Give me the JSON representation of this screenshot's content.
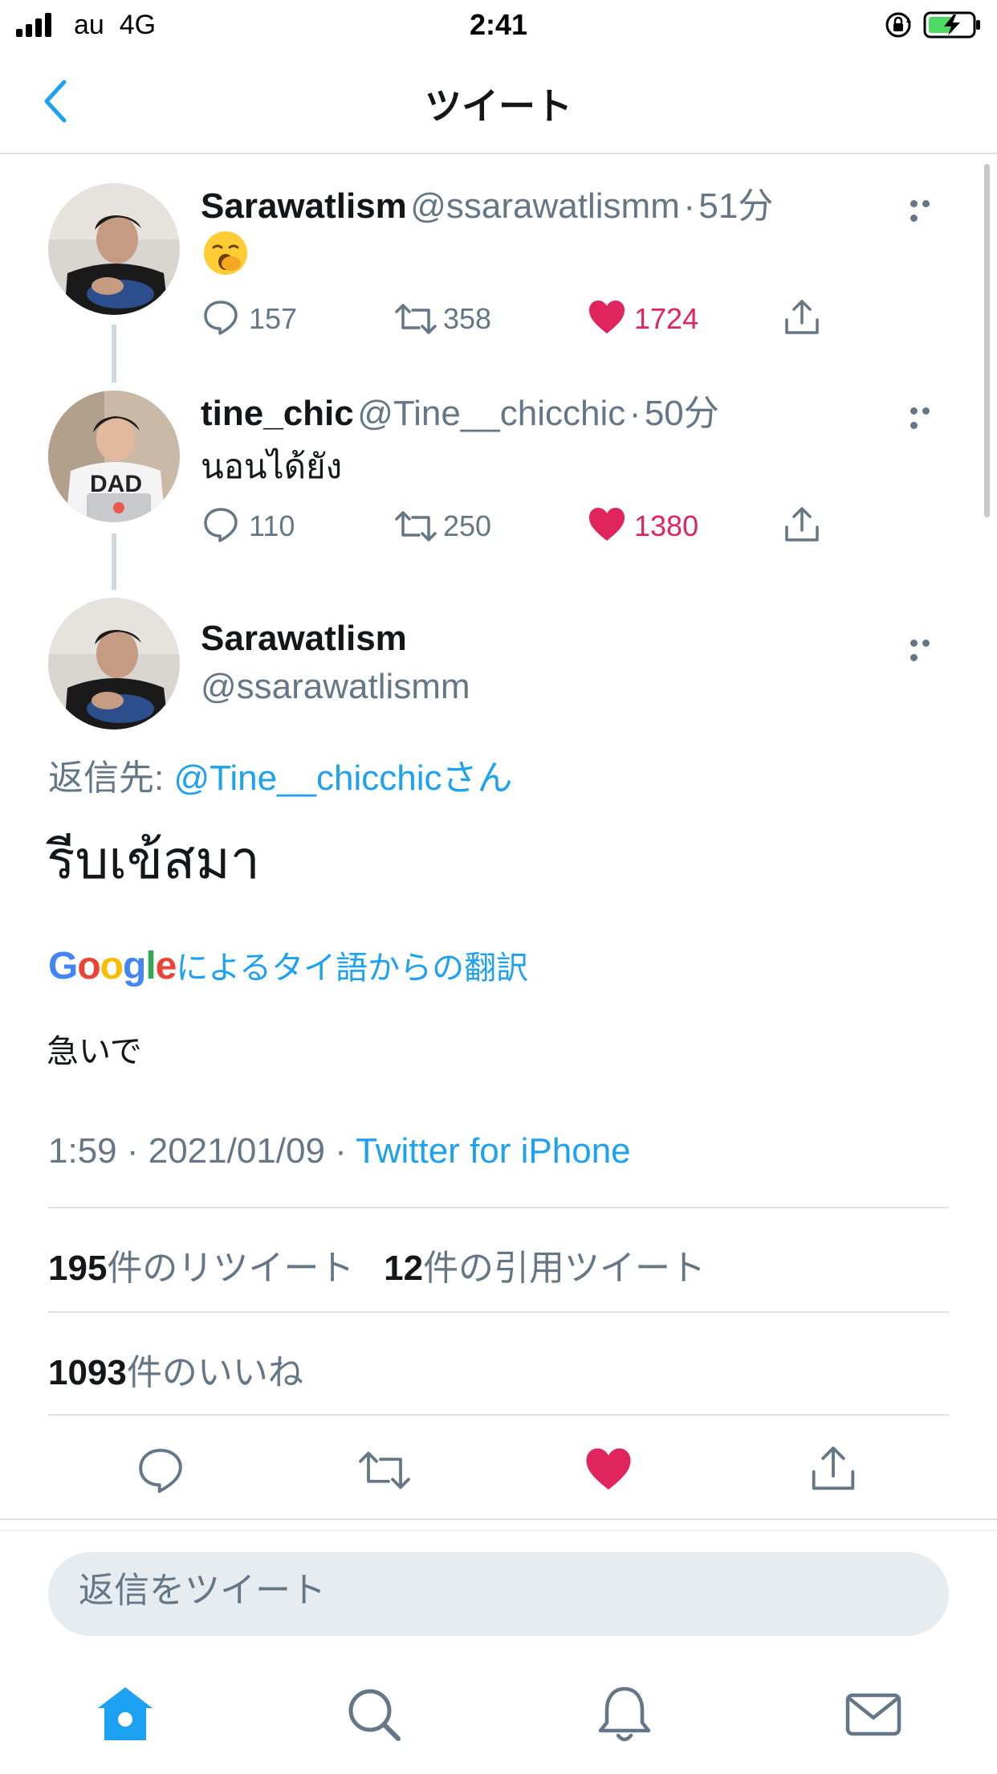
{
  "status_bar": {
    "carrier": "au",
    "network": "4G",
    "time": "2:41"
  },
  "header": {
    "title": "ツイート"
  },
  "tweets": [
    {
      "name": "Sarawatlism",
      "handle": "@ssarawatlismm",
      "dot": "·",
      "time": "51分",
      "content_emoji": "yawning-face-emoji",
      "replies": "157",
      "retweets": "358",
      "likes": "1724"
    },
    {
      "name": "tine_chic",
      "handle": "@Tine__chicchic",
      "dot": "·",
      "time": "50分",
      "text": "นอนได้ยัง",
      "replies": "110",
      "retweets": "250",
      "likes": "1380"
    }
  ],
  "main_tweet": {
    "name": "Sarawatlism",
    "handle": "@ssarawatlismm",
    "reply_prefix": "返信先: ",
    "reply_to": "@Tine__chicchicさん",
    "text": "รีบเข้สมา",
    "translation_brand": "Google",
    "translation_label": "によるタイ語からの翻訳",
    "translation": "急いで",
    "timestamp": "1:59 · 2021/01/09 · ",
    "source": "Twitter for iPhone",
    "retweet_count": "195",
    "retweet_label": "件のリツイート",
    "quote_count": "12",
    "quote_label": "件の引用ツイート",
    "like_count": "1093",
    "like_label": "件のいいね"
  },
  "reply_input": {
    "placeholder": "返信をツイート"
  },
  "colors": {
    "accent": "#1da1f2",
    "like": "#e0245e",
    "muted": "#657786"
  },
  "tab_bar": [
    "home-icon",
    "search-icon",
    "notifications-icon",
    "messages-icon"
  ]
}
